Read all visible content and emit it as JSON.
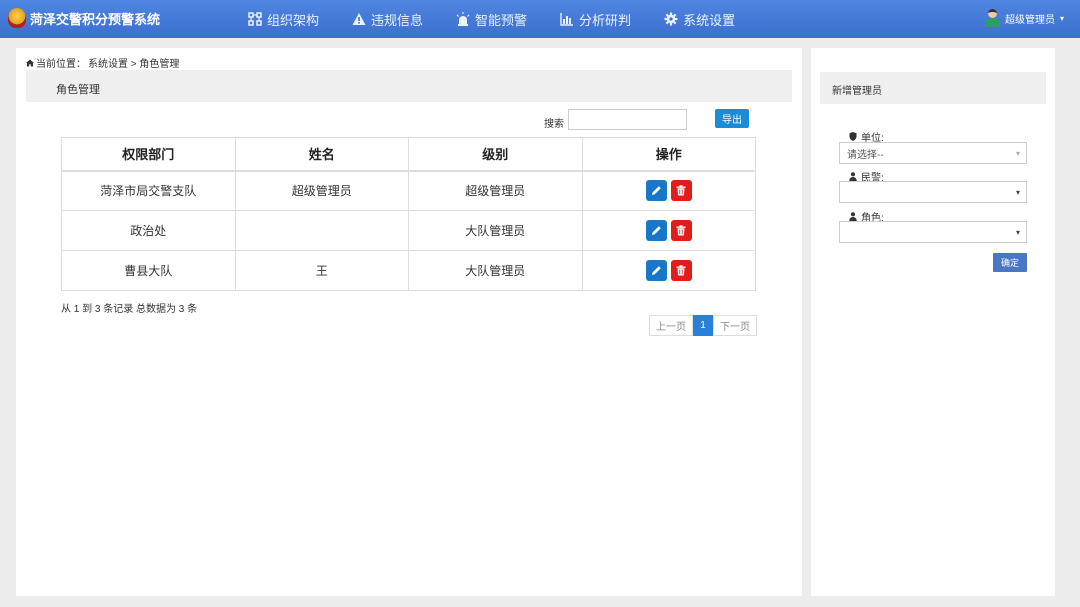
{
  "app": {
    "title": "菏泽交警积分预警系统"
  },
  "nav": [
    {
      "label": "组织架构",
      "icon": "org-chart-icon"
    },
    {
      "label": "违规信息",
      "icon": "warning-icon"
    },
    {
      "label": "智能预警",
      "icon": "alarm-icon"
    },
    {
      "label": "分析研判",
      "icon": "bar-chart-icon"
    },
    {
      "label": "系统设置",
      "icon": "gear-icon"
    }
  ],
  "user": {
    "name": "超级管理员"
  },
  "breadcrumb": {
    "prefix": "当前位置：",
    "path": "系统设置 > 角色管理"
  },
  "section": {
    "title": "角色管理"
  },
  "search": {
    "label": "搜索",
    "value": ""
  },
  "export_label": "导出",
  "table": {
    "headers": [
      "权限部门",
      "姓名",
      "级别",
      "操作"
    ],
    "rows": [
      {
        "dept": "菏泽市局交警支队",
        "name": "超级管理员",
        "level": "超级管理员"
      },
      {
        "dept": "政治处",
        "name": "",
        "level": "大队管理员"
      },
      {
        "dept": "曹县大队",
        "name": "王",
        "level": "大队管理员"
      }
    ]
  },
  "records_text": "从 1 到 3 条记录 总数据为 3 条",
  "pager": {
    "prev": "上一页",
    "current": "1",
    "next": "下一页"
  },
  "side": {
    "title": "新增管理员",
    "unit_label": "单位:",
    "unit_placeholder": "请选择--",
    "police_label": "民警:",
    "police_value": "",
    "role_label": "角色:",
    "role_value": "",
    "confirm_label": "确定"
  },
  "colors": {
    "topbar": "#3b6fcf",
    "primary": "#1a8bd6",
    "danger": "#e41b1b",
    "edit": "#1877c8"
  }
}
